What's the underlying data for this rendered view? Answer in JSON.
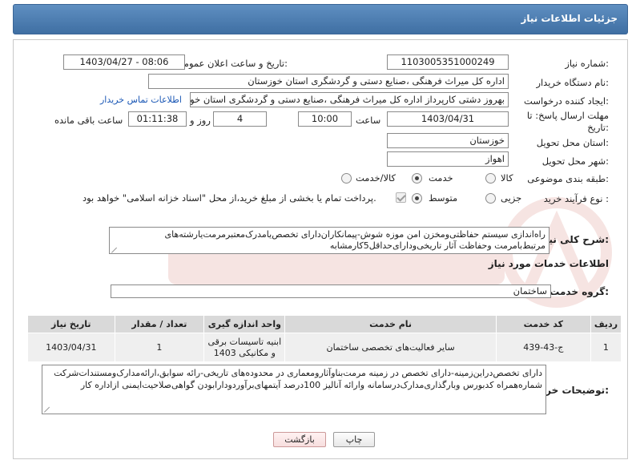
{
  "header": {
    "title": "جزئیات اطلاعات نیاز"
  },
  "need_number": {
    "label": "شماره نیاز:",
    "value": "1103005351000249"
  },
  "announce_datetime": {
    "label": "تاریخ و ساعت اعلان عمومی:",
    "value": "1403/04/27 - 08:06"
  },
  "buyer_org": {
    "label": "نام دستگاه خریدار:",
    "value": "اداره کل میراث فرهنگی ،صنایع دستی و گردشگری استان خوزستان"
  },
  "requester": {
    "label": "ایجاد کننده درخواست:",
    "value": "بهروز دشتی کارپرداز اداره کل میراث فرهنگی ،صنایع دستی و گردشگری استان خوزستان",
    "contact_link": "اطلاعات تماس خریدار"
  },
  "deadline": {
    "label_line1": "مهلت ارسال پاسخ: تا",
    "label_line2": "تاریخ:",
    "date": "1403/04/31",
    "time_label": "ساعت",
    "time": "10:00",
    "days": "4",
    "days_label": "روز و",
    "remaining": "01:11:38",
    "remaining_label": "ساعت باقی مانده"
  },
  "delivery_province": {
    "label": "استان محل تحویل:",
    "value": "خوزستان"
  },
  "delivery_city": {
    "label": "شهر محل تحویل:",
    "value": "اهواز"
  },
  "category": {
    "label": "طبقه بندی موضوعی:",
    "options": [
      "کالا",
      "خدمت",
      "کالا/خدمت"
    ],
    "selected": "خدمت"
  },
  "purchase_process": {
    "label": "نوع فرآیند خرید :",
    "options": [
      "جزیی",
      "متوسط"
    ],
    "selected": "متوسط",
    "payment_note": "پرداخت تمام یا بخشی از مبلغ خرید،از محل \"اسناد خزانه اسلامی\" خواهد بود."
  },
  "summary": {
    "label": "شرح کلی نیاز:",
    "text": "راه‌اندازی سیستم حفاظتی‌ومخزن امن موزه شوش-پیمانکاران‌دارای تخصص‌یامدرک‌معتبرمرمت‌یارشته‌های مرتبط‌بامرمت وحفاظت آثار تاریخی‌ودارای‌حداقل5کارمشابه"
  },
  "services_section": {
    "title": "اطلاعات خدمات مورد نیاز"
  },
  "service_group": {
    "label": "گروه خدمت:",
    "value": "ساختمان"
  },
  "table": {
    "headers": [
      "ردیف",
      "کد خدمت",
      "نام خدمت",
      "واحد اندازه گیری",
      "تعداد / مقدار",
      "تاریخ نیاز"
    ],
    "rows": [
      [
        "1",
        "ج-43-439",
        "سایر فعالیت‌های تخصصی ساختمان",
        "ابنیه تاسیسات برقی و مکانیکی 1403",
        "1",
        "1403/04/31"
      ]
    ]
  },
  "buyer_notes": {
    "label": "توضیحات خریدار:",
    "text": "دارای تخصص‌دراین‌زمینه-دارای تخصص در زمینه مرمت‌بناوآثارومعماری در محدوده‌های تاریخی-رائه سوابق،ارائه‌مدارک‌ومستندات‌شرکت شماره‌همراه کدبورس وبارگذاری‌مدارک‌درسامانه وارائه آنالیز 100درصد آیتمهای‌برآوردودارابودن گواهی‌صلاحیت‌ایمنی ازاداره کار"
  },
  "buttons": {
    "print": "چاپ",
    "back": "بازگشت"
  },
  "colors": {
    "header": "#4a7bb0",
    "link": "#1a57b5",
    "back_button": "#f7dede"
  }
}
